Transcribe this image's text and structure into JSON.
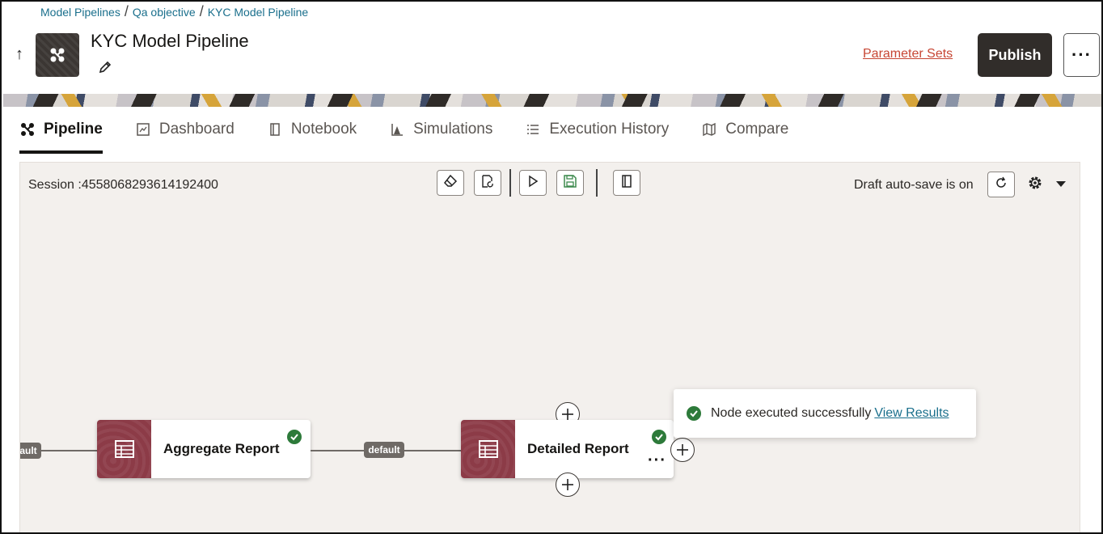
{
  "breadcrumb": {
    "items": [
      "Model Pipelines",
      "Qa objective",
      "KYC Model Pipeline"
    ],
    "separator": "/"
  },
  "header": {
    "title": "KYC Model Pipeline",
    "parameter_sets_label": "Parameter Sets",
    "publish_label": "Publish",
    "more_label": "···"
  },
  "tabs": [
    {
      "label": "Pipeline",
      "icon": "pipeline-icon",
      "active": true
    },
    {
      "label": "Dashboard",
      "icon": "dashboard-icon",
      "active": false
    },
    {
      "label": "Notebook",
      "icon": "notebook-icon",
      "active": false
    },
    {
      "label": "Simulations",
      "icon": "simulations-icon",
      "active": false
    },
    {
      "label": "Execution History",
      "icon": "list-icon",
      "active": false
    },
    {
      "label": "Compare",
      "icon": "map-icon",
      "active": false
    }
  ],
  "canvas": {
    "session_text": "Session :4558068293614192400",
    "autosave_text": "Draft auto-save is on",
    "toolbar": [
      "eraser-icon",
      "reload-page-icon",
      "run-icon",
      "save-icon",
      "notebook-icon"
    ]
  },
  "pipeline": {
    "left_edge_label": "ault",
    "edge_label": "default",
    "nodes": [
      {
        "label": "Aggregate Report",
        "status": "success"
      },
      {
        "label": "Detailed Report",
        "status": "success"
      }
    ]
  },
  "toast": {
    "message": "Node executed successfully",
    "link": "View Results"
  },
  "colors": {
    "accent_link": "#1a6f8c",
    "parameter_link": "#c74634",
    "publish_bg": "#312d2a",
    "node_icon_bg": "#8c3b47",
    "success": "#2d7a3a",
    "canvas_bg": "#f3f0ed"
  }
}
